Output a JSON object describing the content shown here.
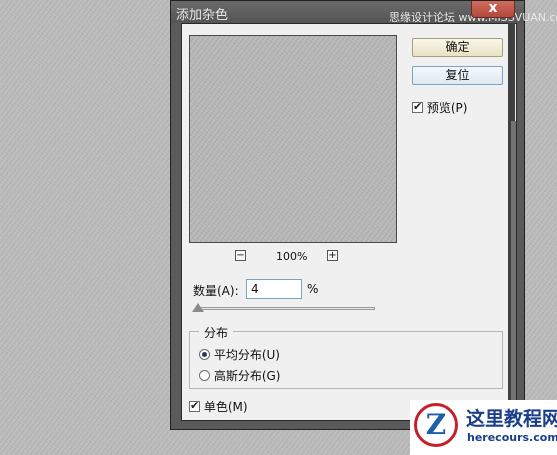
{
  "dialog": {
    "title": "添加杂色",
    "watermark": "思缘设计论坛 www.MISSVUAN.com",
    "close_symbol": "x",
    "ok_label": "确定",
    "reset_label": "复位",
    "preview_label": "预览(P)",
    "preview_checked": true,
    "zoom_out": "−",
    "zoom_in": "+",
    "zoom_level": "100%",
    "amount_label": "数量(A):",
    "amount_value": "4",
    "amount_unit": "%",
    "distribution_title": "分布",
    "distribution_options": [
      {
        "label": "平均分布(U)",
        "selected": true
      },
      {
        "label": "高斯分布(G)",
        "selected": false
      }
    ],
    "monochrome_label": "单色(M)",
    "monochrome_checked": true
  },
  "logo": {
    "mark": "Z",
    "name": "这里教程网",
    "url_text": "herecours.com"
  },
  "colors": {
    "dialog_frame": "#5a5a5a",
    "client_bg": "#f0f0f0",
    "close_button": "#c45a4c",
    "input_focus_border": "#7aa4c7",
    "logo_red": "#c4202b",
    "logo_blue": "#1a3e8c"
  },
  "icons": {
    "check": "check-icon",
    "close": "close-icon",
    "zoom_out": "zoom-out-icon",
    "zoom_in": "zoom-in-icon",
    "slider": "slider-thumb-icon"
  }
}
